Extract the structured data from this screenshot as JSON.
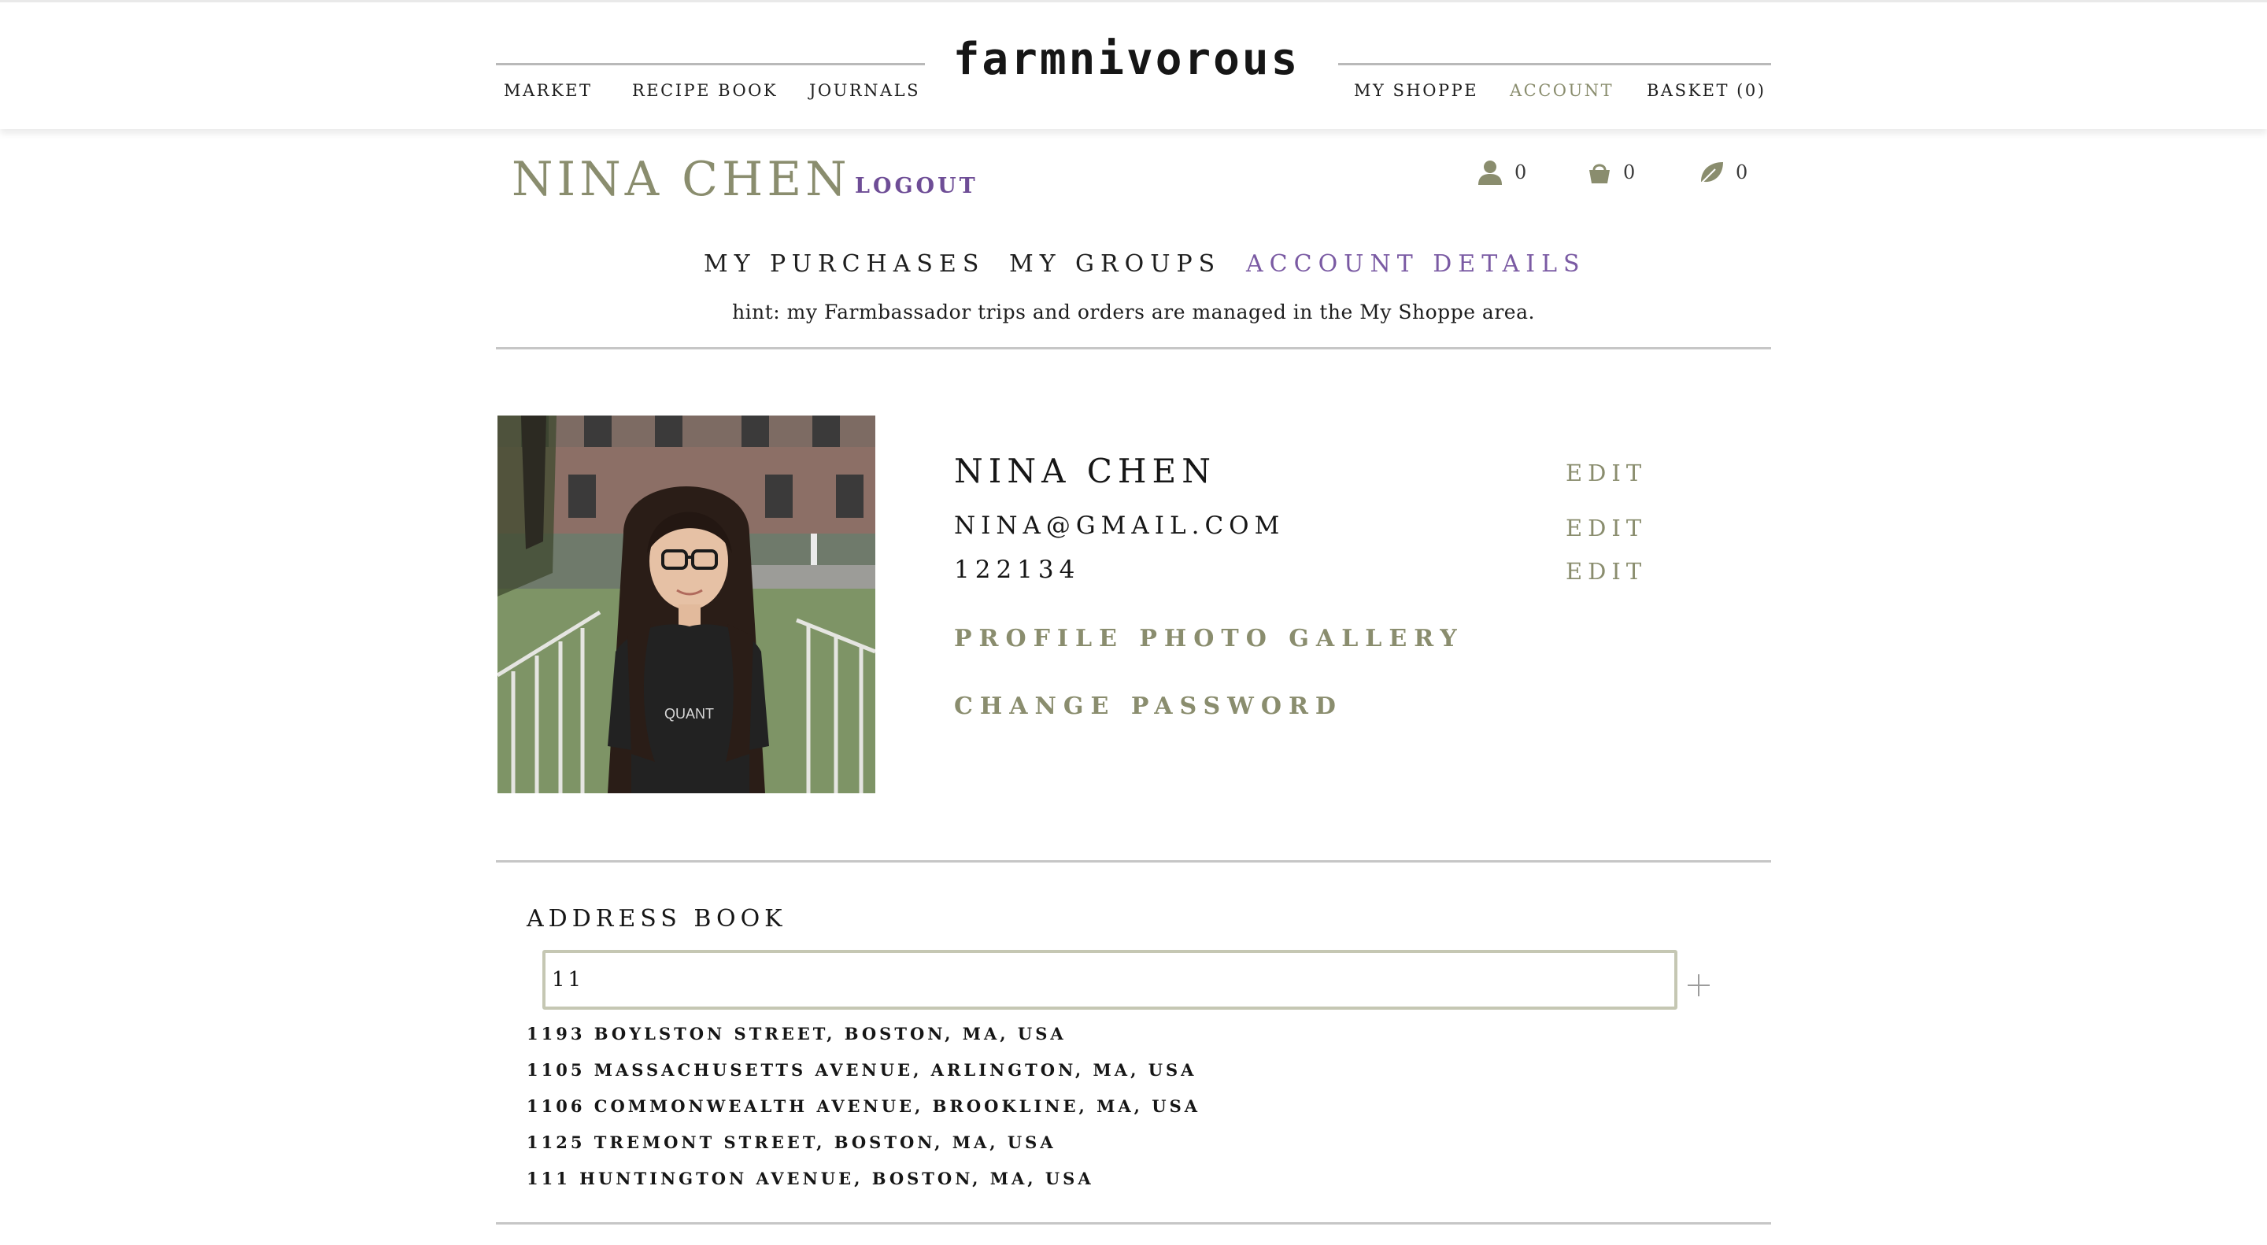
{
  "brand": {
    "logo": "farmnivorous"
  },
  "nav": {
    "left": [
      "MARKET",
      "RECIPE BOOK",
      "JOURNALS"
    ],
    "right": [
      "MY SHOPPE",
      "ACCOUNT",
      "BASKET (0)"
    ],
    "active": "ACCOUNT"
  },
  "account": {
    "name": "NINA CHEN",
    "logout": "LOGOUT",
    "stats": {
      "people": "0",
      "basket": "0",
      "leaf": "0"
    }
  },
  "tabs": {
    "items": [
      "MY PURCHASES",
      "MY GROUPS",
      "ACCOUNT DETAILS"
    ],
    "active": "ACCOUNT DETAILS"
  },
  "hint": "hint: my Farmbassador trips and orders are managed in the My Shoppe area.",
  "profile": {
    "name": "NINA CHEN",
    "email": "NINA@GMAIL.COM",
    "code": "122134",
    "edit_label": "EDIT",
    "gallery_link": "PROFILE PHOTO GALLERY",
    "password_link": "CHANGE PASSWORD",
    "photo_shirt_text": "QUANT"
  },
  "address_book": {
    "title": "ADDRESS BOOK",
    "input_value": "11",
    "suggestions": [
      "1193 BOYLSTON STREET, BOSTON, MA, USA",
      "1105 MASSACHUSETTS AVENUE, ARLINGTON, MA, USA",
      "1106 COMMONWEALTH AVENUE, BROOKLINE, MA, USA",
      "1125 TREMONT STREET, BOSTON, MA, USA",
      "111 HUNTINGTON AVENUE, BOSTON, MA, USA"
    ]
  },
  "colors": {
    "olive_accent": "#8a8d6e",
    "purple_accent": "#7a5aa3",
    "logout_purple": "#6e4d96",
    "input_border": "#c5c7b3"
  },
  "icons": [
    "person-icon",
    "basket-icon",
    "leaf-icon",
    "plus-icon"
  ]
}
